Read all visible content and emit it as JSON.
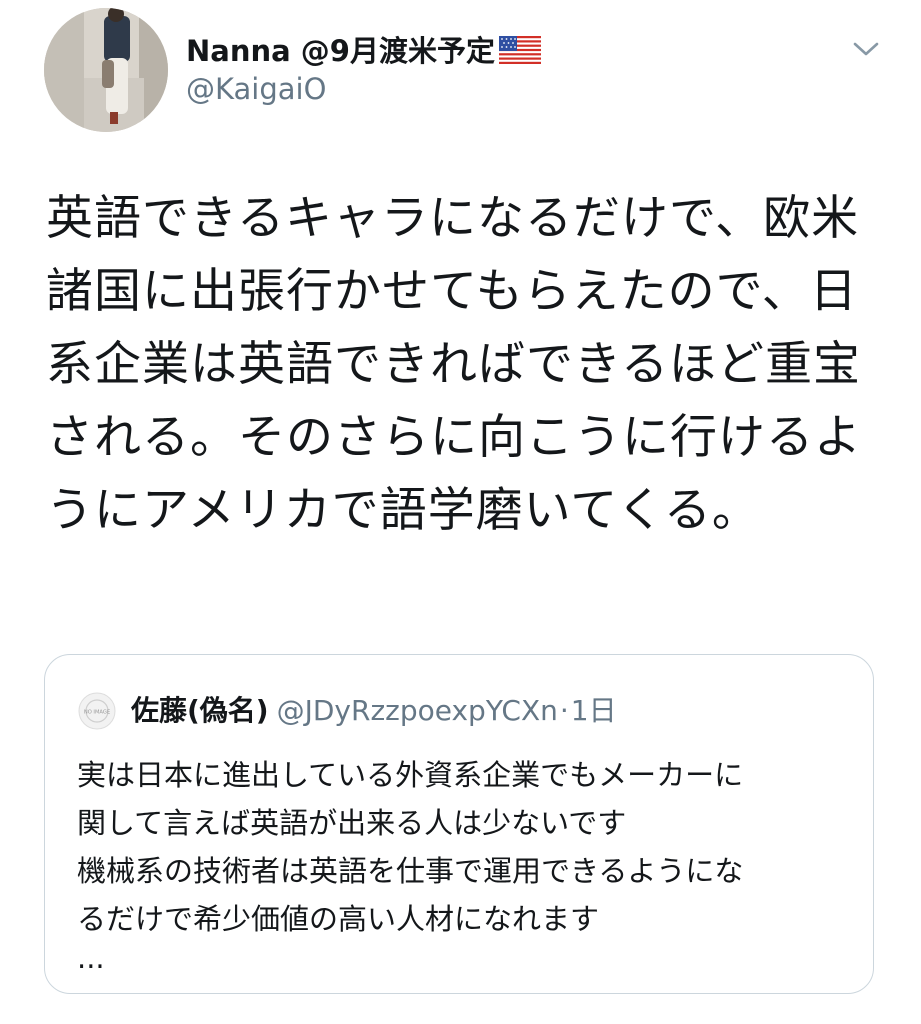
{
  "tweet": {
    "author": {
      "display_name": "Nanna @9月渡米予定",
      "handle": "@KaigaiO",
      "flag_icon": "us-flag-icon"
    },
    "text": "英語できるキャラになるだけで、欧米諸国に出張行かせてもらえたので、日系企業は英語できればできるほど重宝される。そのさらに向こうに行けるようにアメリカで語学磨いてくる。",
    "quoted": {
      "author_name": "佐藤(偽名)",
      "handle": "@JDyRzzpoexpYCXn",
      "separator": "·",
      "time": "1日",
      "avatar_text": "NO IMAGE",
      "lines": [
        "実は日本に進出している外資系企業でもメーカーに",
        "関して言えば英語が出来る人は少ないです",
        "機械系の技術者は英語を仕事で運用できるようにな",
        "るだけで希少価値の高い人材になれます"
      ],
      "ellipsis": "..."
    }
  },
  "colors": {
    "text": "#14171a",
    "secondary": "#657786",
    "border": "#ccd6dd"
  }
}
